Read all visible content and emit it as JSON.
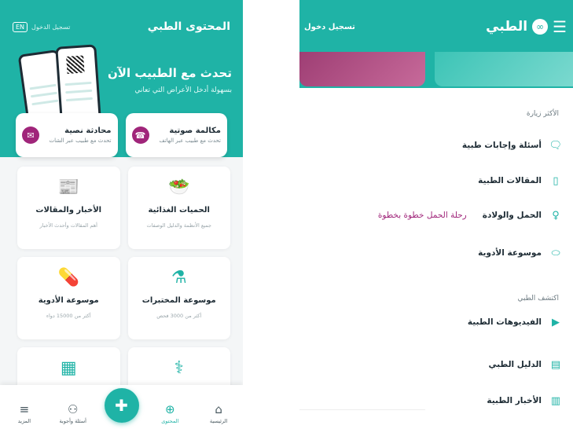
{
  "colors": {
    "brand": "#1fb3a6",
    "accent": "#a0257a",
    "text": "#1d2b34"
  },
  "left": {
    "header_title": "المحتوى الطبي",
    "login_label": "تسجيل الدخول",
    "lang_label": "EN",
    "hero_heading": "تحدث مع الطبيب الآن",
    "hero_sub": "بسهولة أدخل الأعراض التي تعاني",
    "contact": [
      {
        "title": "مكالمة صوتية",
        "desc": "تحدث مع طبيب عبر الهاتف",
        "icon": "phone-icon",
        "glyph": "☎"
      },
      {
        "title": "محادثة نصية",
        "desc": "تحدث مع طبيب عبر الشات",
        "icon": "chat-icon",
        "glyph": "✉"
      }
    ],
    "tiles": [
      {
        "title": "الحميات الغذائية",
        "desc": "جميع الأنظمة والدليل الوصفات",
        "icon": "food-bowl-icon",
        "glyph": "🥗"
      },
      {
        "title": "الأخبار والمقالات",
        "desc": "أهم المقالات وأحدث الأخبار",
        "icon": "newspaper-icon",
        "glyph": "📰"
      },
      {
        "title": "موسوعة المختبرات",
        "desc": "أكثر من 3000 فحص",
        "icon": "lab-flask-icon",
        "glyph": "⚗"
      },
      {
        "title": "موسوعة الأدوية",
        "desc": "أكثر من 15000 دواء",
        "icon": "pill-icon",
        "glyph": "💊"
      },
      {
        "title": "",
        "desc": "",
        "icon": "stethoscope-icon",
        "glyph": "⚕"
      },
      {
        "title": "",
        "desc": "",
        "icon": "id-card-icon",
        "glyph": "▦"
      }
    ],
    "nav": [
      {
        "label": "الرئيسية",
        "icon": "home-icon",
        "glyph": "⌂"
      },
      {
        "label": "المحتوى",
        "icon": "content-icon",
        "glyph": "⊕"
      },
      {
        "label": "",
        "icon": "consult-fab-icon",
        "glyph": "✚"
      },
      {
        "label": "أسئلة وأجوبة",
        "icon": "qa-icon",
        "glyph": "⚇"
      },
      {
        "label": "المزيد",
        "icon": "menu-icon",
        "glyph": "≡"
      }
    ]
  },
  "right": {
    "logo_text": "الطبي",
    "login_label": "تسجيل دخول",
    "most_visited_label": "الأكثر زيارة",
    "explore_label": "اكتشف الطبي",
    "most_visited": [
      {
        "label": "أسئلة وإجابات طبية",
        "extra": "",
        "icon": "qa-bubble-icon",
        "glyph": "🗨"
      },
      {
        "label": "المقالات الطبية",
        "extra": "",
        "icon": "article-icon",
        "glyph": "▯"
      },
      {
        "label": "الحمل والولادة",
        "extra": "رحلة الحمل خطوة بخطوة",
        "icon": "pregnancy-icon",
        "glyph": "♀"
      },
      {
        "label": "موسوعة الأدوية",
        "extra": "",
        "icon": "pill-icon",
        "glyph": "⬭"
      }
    ],
    "explore": [
      {
        "label": "الفيديوهات الطبية",
        "icon": "video-play-icon",
        "glyph": "▶"
      },
      {
        "label": "الدليل الطبي",
        "icon": "directory-icon",
        "glyph": "▤"
      },
      {
        "label": "الأخبار الطبية",
        "icon": "news-icon",
        "glyph": "▥"
      }
    ]
  }
}
